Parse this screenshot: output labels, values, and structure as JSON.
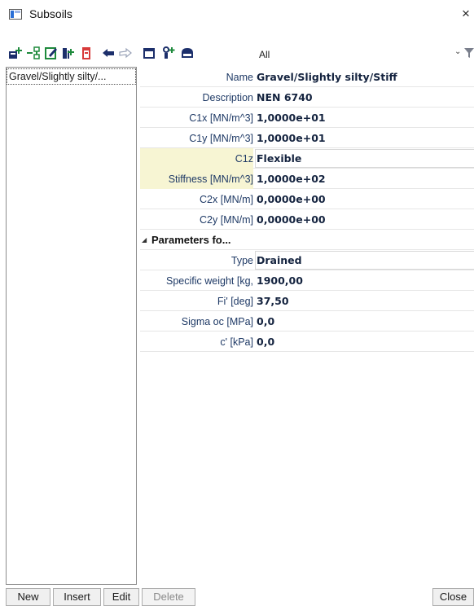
{
  "window": {
    "title": "Subsoils",
    "close_glyph": "×"
  },
  "toolbar": {
    "icons": [
      "new-icon",
      "insert-icon",
      "edit-icon",
      "copy-icon",
      "delete-icon",
      "undo-icon",
      "redo-icon",
      "table-icon",
      "sort-icon",
      "save-icon"
    ],
    "filter_value": "All",
    "dropdown_glyph": "⌄"
  },
  "list": {
    "items": [
      "Gravel/Slightly silty/..."
    ]
  },
  "properties": {
    "rows": [
      {
        "label": "Name",
        "value": "Gravel/Slightly silty/Stiff"
      },
      {
        "label": "Description",
        "value": "NEN 6740"
      },
      {
        "label": "C1x [MN/m^3]",
        "value": "1,0000e+01"
      },
      {
        "label": "C1y [MN/m^3]",
        "value": "1,0000e+01"
      },
      {
        "label": "C1z",
        "value": "Flexible"
      },
      {
        "label": "Stiffness [MN/m^3]",
        "value": "1,0000e+02"
      },
      {
        "label": "C2x [MN/m]",
        "value": "0,0000e+00"
      },
      {
        "label": "C2y [MN/m]",
        "value": "0,0000e+00"
      }
    ],
    "section": {
      "title": "Parameters fo...",
      "rows": [
        {
          "label": "Type",
          "value": "Drained"
        },
        {
          "label": "Specific weight [kg,",
          "value": "1900,00"
        },
        {
          "label": "Fi' [deg]",
          "value": "37,50"
        },
        {
          "label": "Sigma oc [MPa]",
          "value": "0,0"
        },
        {
          "label": "c' [kPa]",
          "value": "0,0"
        }
      ]
    }
  },
  "buttons": {
    "new": "New",
    "insert": "Insert",
    "edit": "Edit",
    "delete": "Delete",
    "close": "Close"
  },
  "colors": {
    "highlight": "#f7f5d3",
    "label_text": "#1f3a66",
    "toolbar_green": "#1e8a3c",
    "toolbar_red": "#d83a3a",
    "toolbar_navy": "#1c2f6b"
  }
}
